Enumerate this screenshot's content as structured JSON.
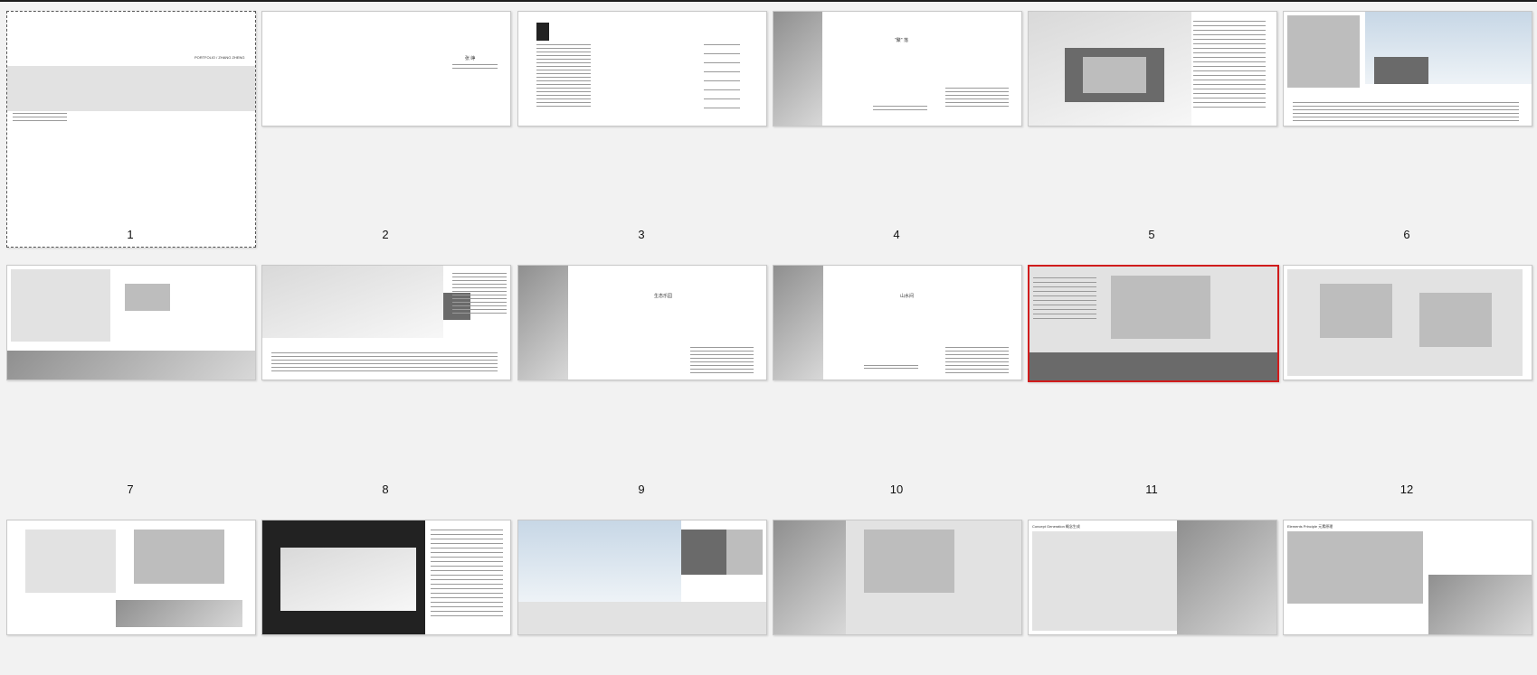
{
  "viewer": {
    "slides": [
      {
        "number": "1",
        "text": "PORTFOLIO / ZHANG ZHENG"
      },
      {
        "number": "2",
        "text": "张 峥"
      },
      {
        "number": "3",
        "text": ""
      },
      {
        "number": "4",
        "text": "\"聚\" 落"
      },
      {
        "number": "5",
        "text": ""
      },
      {
        "number": "6",
        "text": ""
      },
      {
        "number": "7",
        "text": ""
      },
      {
        "number": "8",
        "text": ""
      },
      {
        "number": "9",
        "text": "山水间"
      },
      {
        "number": "10",
        "text": ""
      },
      {
        "number": "11",
        "text": ""
      },
      {
        "number": "12",
        "text": ""
      },
      {
        "number": "",
        "text": ""
      },
      {
        "number": "",
        "text": ""
      },
      {
        "number": "",
        "text": "Concept Generation 概念生成"
      },
      {
        "number": "",
        "text": "Elements Principle 元素原理"
      },
      {
        "number": "",
        "text": ""
      },
      {
        "number": "",
        "text": "生态乐园"
      }
    ],
    "selected_index": 10,
    "focused_index": 0
  }
}
